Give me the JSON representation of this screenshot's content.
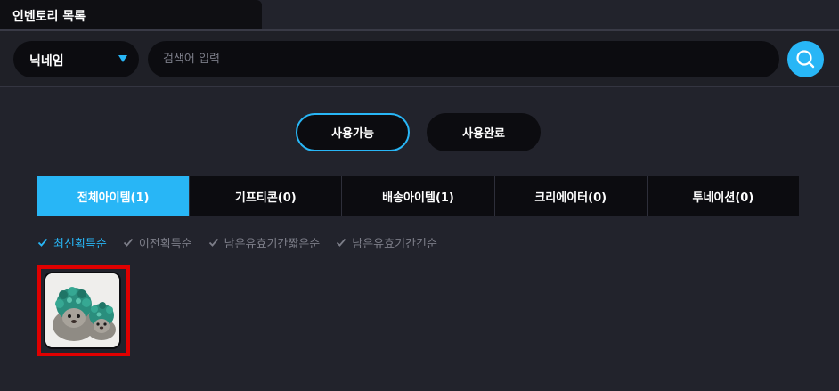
{
  "window": {
    "title": "인벤토리 목록"
  },
  "search": {
    "filter_selected": "닉네임",
    "placeholder": "검색어 입력"
  },
  "status_toggle": {
    "available_label": "사용가능",
    "used_label": "사용완료",
    "active": "사용가능"
  },
  "tabs": [
    {
      "label": "전체아이템(1)",
      "active": true
    },
    {
      "label": "기프티콘(0)",
      "active": false
    },
    {
      "label": "배송아이템(1)",
      "active": false
    },
    {
      "label": "크리에이터(0)",
      "active": false
    },
    {
      "label": "투네이션(0)",
      "active": false
    }
  ],
  "sort_options": [
    {
      "label": "최신획득순",
      "active": true
    },
    {
      "label": "이전획득순",
      "active": false
    },
    {
      "label": "남은유효기간짧은순",
      "active": false
    },
    {
      "label": "남은유효기간긴순",
      "active": false
    }
  ],
  "items": [
    {
      "icon": "hedgehog-plush-image",
      "selected": true
    }
  ],
  "colors": {
    "accent": "#28b6f6",
    "background": "#22232c",
    "panel": "#0c0c10",
    "highlight": "#e00000"
  },
  "icons": {
    "search": "search-icon",
    "caret": "chevron-down-icon",
    "check": "check-icon"
  }
}
